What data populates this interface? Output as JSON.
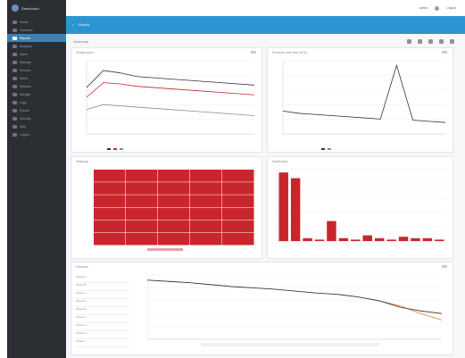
{
  "app": {
    "brand": "Dashboard"
  },
  "sidebar": {
    "items": [
      {
        "label": "Home"
      },
      {
        "label": "Overview"
      },
      {
        "label": "Reports",
        "active": true
      },
      {
        "label": "Analytics"
      },
      {
        "label": "Users"
      },
      {
        "label": "Settings"
      },
      {
        "label": "Devices"
      },
      {
        "label": "Alerts"
      },
      {
        "label": "Network"
      },
      {
        "label": "Storage"
      },
      {
        "label": "Logs"
      },
      {
        "label": "Events"
      },
      {
        "label": "Security"
      },
      {
        "label": "Help"
      },
      {
        "label": "Logout"
      }
    ]
  },
  "topbar": {
    "user": "admin",
    "user2": "Logout"
  },
  "subnav": {
    "crumb": "Reports"
  },
  "page": {
    "title": "Summary"
  },
  "panels": {
    "p1": {
      "title": "Temperature"
    },
    "p2": {
      "title": "Pressure over time (kPa)"
    },
    "p3": {
      "title": "Heatmap"
    },
    "p4": {
      "title": "Distribution"
    },
    "p5": {
      "title": "Forecast",
      "left_labels": [
        "Series A",
        "Series B",
        "Series C",
        "Series D",
        "Series E",
        "Series F",
        "Series G",
        "Series H",
        "Series I"
      ]
    }
  },
  "colors": {
    "accent": "#2c95d1",
    "sidebar": "#2b2e33",
    "heat": "#c8262c",
    "bar": "#c8262c",
    "line_dark": "#333333",
    "line_orange": "#e07b39"
  },
  "chart_data": [
    {
      "type": "line",
      "series": [
        {
          "values": [
            38,
            52,
            50,
            47,
            46,
            45,
            44,
            43,
            42,
            41,
            40
          ]
        },
        {
          "values": [
            30,
            42,
            41,
            39,
            38,
            37,
            36,
            35,
            34,
            33,
            32
          ]
        },
        {
          "values": [
            20,
            24,
            23,
            22,
            21,
            20,
            19,
            18,
            17,
            16,
            15
          ]
        }
      ]
    },
    {
      "type": "line",
      "series": [
        {
          "values": [
            20,
            18,
            17,
            16,
            15,
            14,
            13,
            60,
            12,
            11,
            10
          ]
        }
      ]
    },
    {
      "type": "heatmap",
      "rows": 6,
      "cols": 5
    },
    {
      "type": "bar",
      "values": [
        48,
        44,
        2,
        1,
        14,
        2,
        1,
        4,
        2,
        1,
        3,
        2,
        2,
        1
      ]
    },
    {
      "type": "line",
      "series": [
        {
          "values": [
            92,
            90,
            88,
            85,
            82,
            80,
            78,
            75,
            72,
            70,
            66,
            60,
            50,
            44,
            40
          ]
        },
        {
          "values": [
            92,
            90,
            88,
            85,
            82,
            80,
            78,
            75,
            72,
            70,
            66,
            60,
            52,
            40,
            30
          ]
        }
      ]
    }
  ]
}
